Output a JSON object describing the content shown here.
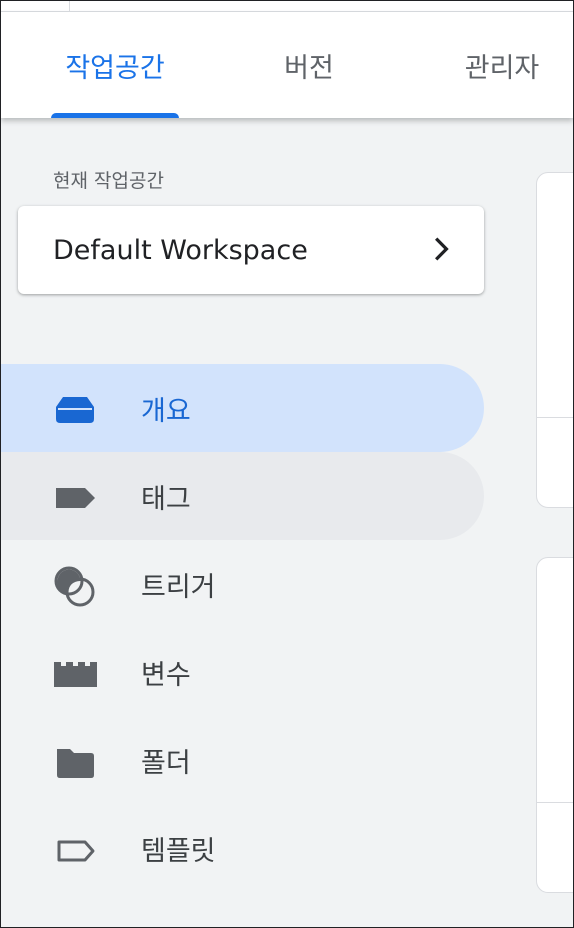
{
  "tabs": [
    {
      "label": "작업공간",
      "active": true
    },
    {
      "label": "버전",
      "active": false
    },
    {
      "label": "관리자",
      "active": false
    }
  ],
  "workspace": {
    "section_label": "현재 작업공간",
    "name": "Default Workspace",
    "chevron_icon": "chevron-right-icon"
  },
  "nav": [
    {
      "label": "개요",
      "icon": "overview-tray-icon",
      "selected": true
    },
    {
      "label": "태그",
      "icon": "tag-icon",
      "selected": false
    },
    {
      "label": "트리거",
      "icon": "trigger-circles-icon",
      "selected": false
    },
    {
      "label": "변수",
      "icon": "variables-blocks-icon",
      "selected": false
    },
    {
      "label": "폴더",
      "icon": "folder-icon",
      "selected": false
    },
    {
      "label": "템플릿",
      "icon": "template-tag-outline-icon",
      "selected": false
    }
  ],
  "colors": {
    "accent": "#1a73e8",
    "selected_bg": "#d2e3fc",
    "hover_bg": "#e8eaed",
    "icon": "#5f6368",
    "page_bg": "#f1f3f4"
  }
}
